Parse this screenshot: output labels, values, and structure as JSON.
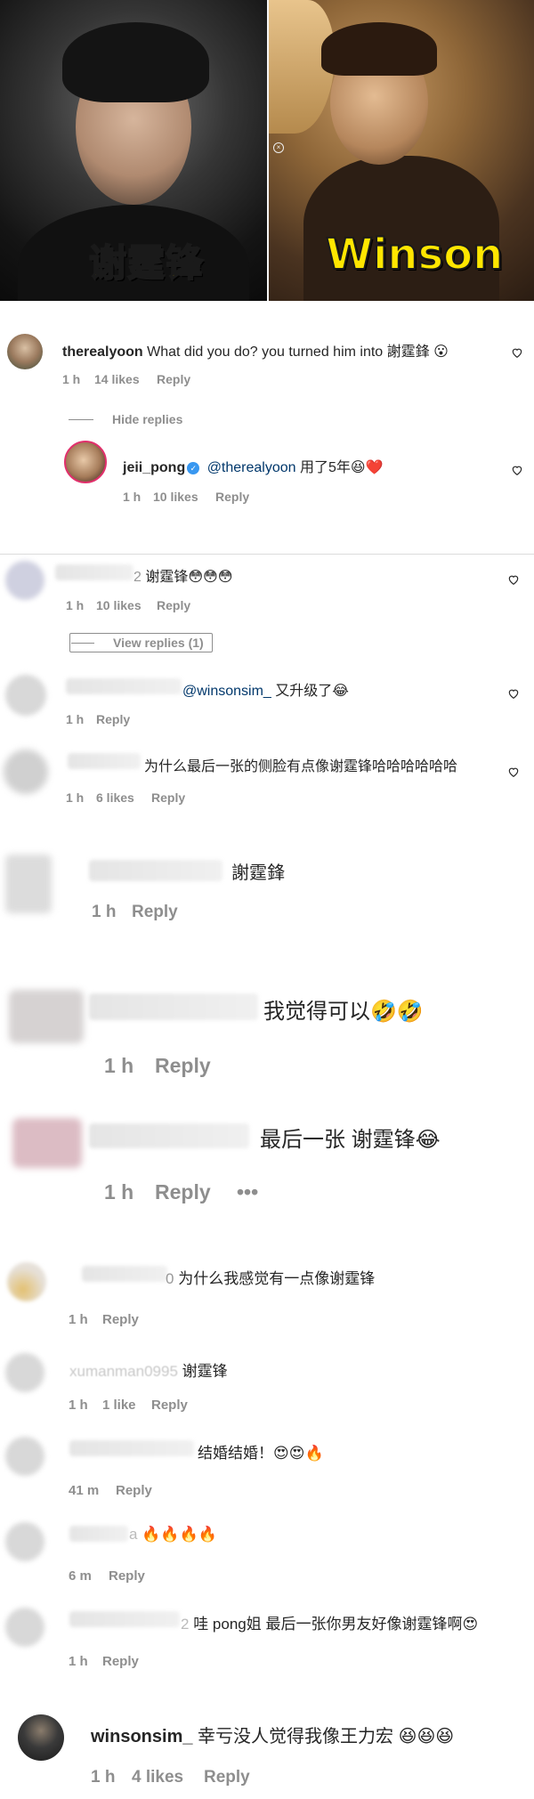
{
  "hero": {
    "left_label": "谢霆锋",
    "right_label": "Winson"
  },
  "comments": [
    {
      "user": "therealyoon",
      "text": "What did you do? you turned him into 謝霆鋒",
      "emoji": "😮",
      "time": "1 h",
      "likes": "14 likes",
      "reply": "Reply",
      "hide_replies": "Hide replies",
      "reply_thread": {
        "user": "jeii_pong",
        "verified_icon": "verified-badge-icon",
        "mention": "@therealyoon",
        "text": "用了5年",
        "emoji": "😆❤️",
        "time": "1 h",
        "likes": "10 likes",
        "reply": "Reply"
      }
    },
    {
      "user_partial": "2",
      "text": "谢霆锋",
      "emoji": "😳😳😳",
      "time": "1 h",
      "likes": "10 likes",
      "reply": "Reply",
      "view_replies": "View replies (1)"
    },
    {
      "mention": "@winsonsim_",
      "text": "又升级了",
      "emoji": "😂",
      "time": "1 h",
      "reply": "Reply"
    },
    {
      "text": "为什么最后一张的侧脸有点像谢霆锋哈哈哈哈哈哈",
      "time": "1 h",
      "likes": "6 likes",
      "reply": "Reply"
    },
    {
      "text": "謝霆鋒",
      "time": "1 h",
      "reply": "Reply"
    },
    {
      "text": "我觉得可以",
      "emoji": "🤣🤣",
      "time": "1 h",
      "reply": "Reply"
    },
    {
      "text": "最后一张 谢霆锋",
      "emoji": "😂",
      "time": "1 h",
      "reply": "Reply",
      "more": "•••"
    },
    {
      "user_partial": "0",
      "text": "为什么我感觉有一点像谢霆锋",
      "time": "1 h",
      "reply": "Reply"
    },
    {
      "user_partial": "xumanman0995",
      "text": "谢霆锋",
      "time": "1 h",
      "likes": "1 like",
      "reply": "Reply"
    },
    {
      "text": "结婚结婚！",
      "emoji": "😍😍🔥",
      "time": "41 m",
      "reply": "Reply"
    },
    {
      "user_partial": "a",
      "emoji": "🔥🔥🔥🔥",
      "time": "6 m",
      "reply": "Reply"
    },
    {
      "user_partial": "2",
      "text": "哇 pong姐 最后一张你男友好像谢霆锋啊",
      "emoji": "😍",
      "time": "1 h",
      "reply": "Reply"
    },
    {
      "user": "winsonsim_",
      "text": "幸亏没人觉得我像王力宏",
      "emoji": "😆😆😆",
      "time": "1 h",
      "likes": "4 likes",
      "reply": "Reply"
    }
  ]
}
